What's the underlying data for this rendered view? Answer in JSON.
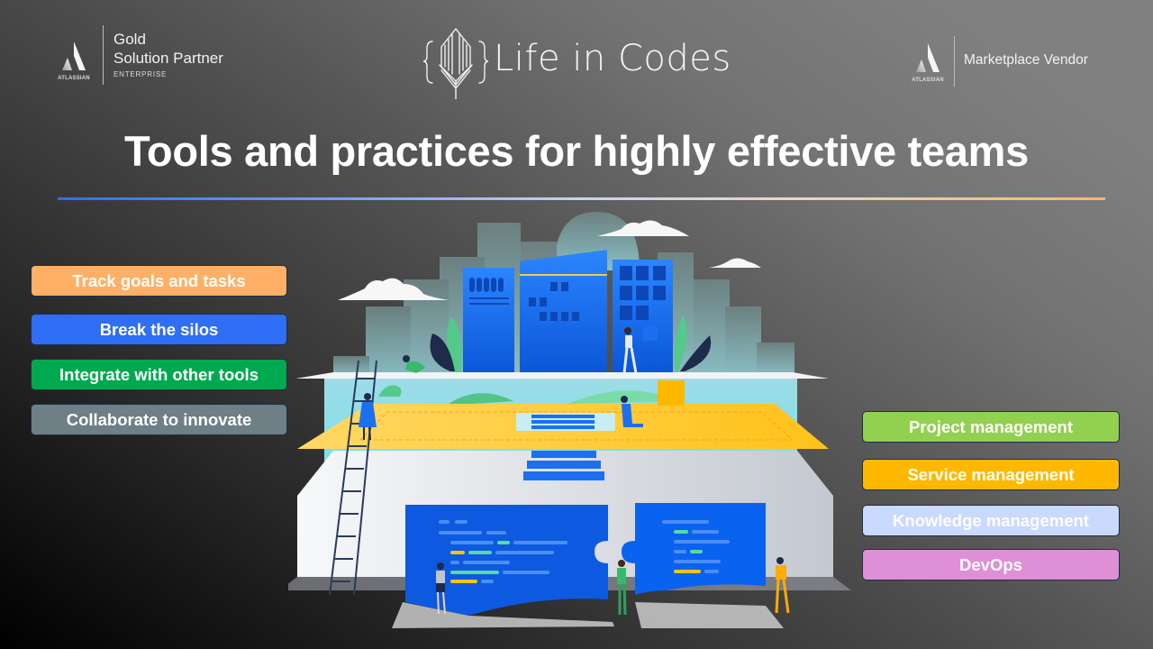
{
  "header": {
    "partner_badge": {
      "logo_word": "ATLASSIAN",
      "line1": "Gold",
      "line2": "Solution Partner",
      "line3": "ENTERPRISE",
      "icon": "atlassian-logo-icon"
    },
    "brand": {
      "name": "Life in Codes",
      "icon": "leaf-braces-logo-icon"
    },
    "vendor_badge": {
      "logo_word": "ATLASSIAN",
      "label": "Marketplace Vendor",
      "icon": "atlassian-logo-icon"
    }
  },
  "title": "Tools and practices for highly effective teams",
  "divider_colors": [
    "#2f6cf0",
    "#c7d3f0",
    "#f6b86a"
  ],
  "left_pills": [
    {
      "label": "Track goals and tasks",
      "color": "#ffb066"
    },
    {
      "label": "Break the silos",
      "color": "#2f6ef5"
    },
    {
      "label": "Integrate with other tools",
      "color": "#00a94f"
    },
    {
      "label": "Collaborate to innovate",
      "color": "#6e7f85"
    }
  ],
  "right_pills": [
    {
      "label": "Project management",
      "color": "#92d050"
    },
    {
      "label": "Service management",
      "color": "#ffb800"
    },
    {
      "label": "Knowledge management",
      "color": "#c9d9ff"
    },
    {
      "label": "DevOps",
      "color": "#df8fd5"
    }
  ],
  "illustration": {
    "description": "Isometric team collaboration scene with city buildings, yellow platform, stairs, ladder, puzzle pieces with code lines",
    "icon": "team-collaboration-illustration"
  }
}
